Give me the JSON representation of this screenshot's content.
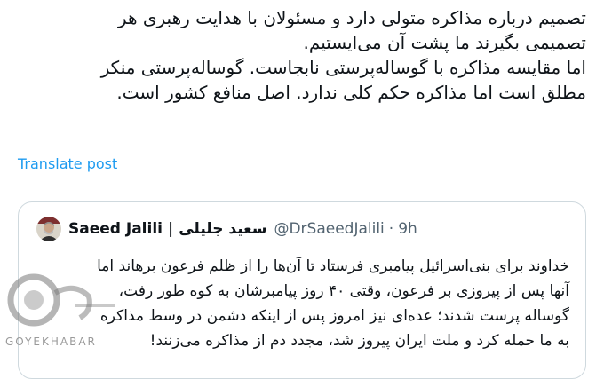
{
  "tweet": {
    "lines": [
      "تصمیم درباره مذاکره متولی دارد و مسئولان با هدایت رهبری هر",
      "تصمیمی بگیرند ما پشت آن می‌ایستیم.",
      "اما مقایسه مذاکره با گوساله‌پرستی نابجاست. گوساله‌پرستی منکر",
      "مطلق است اما مذاکره حکم کلی ندارد. اصل منافع کشور است."
    ],
    "translate_label": "Translate post"
  },
  "quote": {
    "author_name": "Saeed Jalili",
    "separator": "|",
    "author_name_fa": "سعید جلیلی",
    "handle": "@DrSaeedJalili",
    "dot": "·",
    "time": "9h",
    "lines": [
      "خداوند برای بنی‌اسرائیل پیامبری فرستاد تا آن‌ها را از ظلم فرعون برهاند اما",
      "آنها پس از پیروزی بر فرعون، وقتی ۴۰ روز پیامبرشان به کوه طور رفت،",
      "گوساله پرست شدند؛ عده‌ای نیز امروز پس از اینکه دشمن در وسط مذاکره",
      "به ما حمله کرد و ملت ایران پیروز شد، مجدد دم از مذاکره می‌زنند!"
    ]
  },
  "watermark": {
    "text": "GOYEKHABAR",
    "logo": "goyekhabar-logo"
  },
  "colors": {
    "link": "#1d9bf0",
    "text": "#0f1419",
    "secondary": "#536471",
    "border": "#cfd9de"
  }
}
